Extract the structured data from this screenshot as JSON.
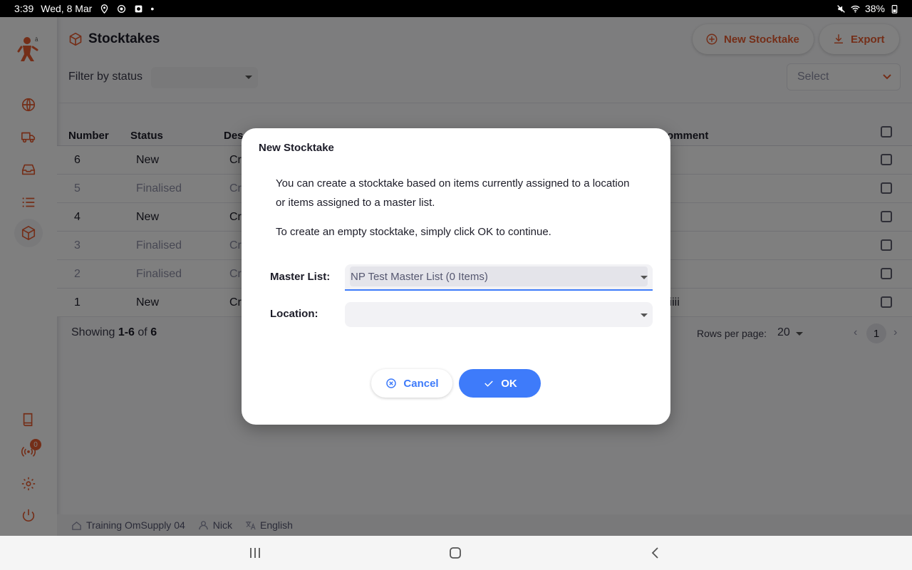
{
  "status_bar": {
    "time": "3:39",
    "date": "Wed, 8 Mar",
    "battery": "38%",
    "dot": "•"
  },
  "sidebar": {
    "items": [
      {
        "icon": "globe-icon"
      },
      {
        "icon": "truck-icon"
      },
      {
        "icon": "inbox-icon"
      },
      {
        "icon": "list-icon"
      },
      {
        "icon": "box-icon",
        "active": true
      }
    ],
    "bottom_items": [
      {
        "icon": "book-icon"
      },
      {
        "icon": "sync-icon",
        "badge": "0"
      },
      {
        "icon": "gear-icon"
      },
      {
        "icon": "power-icon"
      }
    ]
  },
  "header": {
    "title": "Stocktakes",
    "new_button": "New Stocktake",
    "export_button": "Export",
    "filter_label": "Filter by status",
    "select_placeholder": "Select"
  },
  "table": {
    "columns": [
      "Number",
      "Status",
      "Des",
      "omment"
    ],
    "rows": [
      {
        "number": "6",
        "status": "New",
        "desc": "Cr",
        "comment": ""
      },
      {
        "number": "5",
        "status": "Finalised",
        "desc": "Cr",
        "comment": ""
      },
      {
        "number": "4",
        "status": "New",
        "desc": "Cr",
        "comment": ""
      },
      {
        "number": "3",
        "status": "Finalised",
        "desc": "Cr",
        "comment": ""
      },
      {
        "number": "2",
        "status": "Finalised",
        "desc": "Cr",
        "comment": ""
      },
      {
        "number": "1",
        "status": "New",
        "desc": "Cr",
        "comment": "iiiii"
      }
    ]
  },
  "pagination": {
    "showing_prefix": "Showing",
    "range": "1-6",
    "of": "of",
    "total": "6",
    "rows_per_page_label": "Rows per page:",
    "rows_per_page": "20",
    "current_page": "1"
  },
  "footer": {
    "store": "Training OmSupply 04",
    "user": "Nick",
    "language": "English"
  },
  "dialog": {
    "title": "New Stocktake",
    "text1": "You can create a stocktake based on items currently assigned to a location or items assigned to a master list.",
    "text2": "To create an empty stocktake, simply click OK to continue.",
    "master_list_label": "Master List:",
    "master_list_value": "NP Test Master List (0 Items)",
    "location_label": "Location:",
    "location_value": "",
    "cancel": "Cancel",
    "ok": "OK"
  },
  "colors": {
    "accent": "#e95c30",
    "primary": "#3e7bfa"
  }
}
